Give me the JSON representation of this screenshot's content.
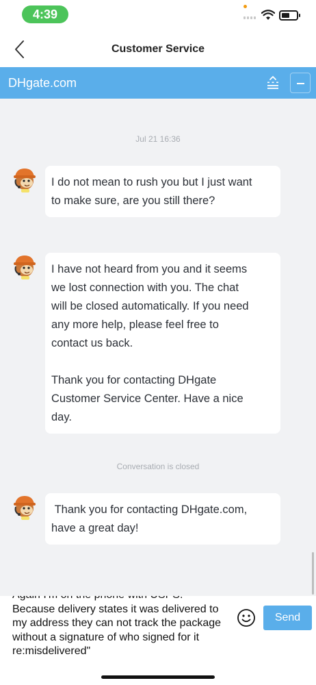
{
  "status_bar": {
    "time": "4:39",
    "time_pill_color": "#4cc45a",
    "icons": [
      "signal-icon",
      "wifi-icon",
      "battery-icon"
    ]
  },
  "nav": {
    "back_icon": "chevron-left-icon",
    "title": "Customer Service"
  },
  "brand_bar": {
    "name": "DHgate.com",
    "color": "#5aaeea",
    "icons": [
      "expand-icon",
      "minimize-icon"
    ]
  },
  "chat": {
    "timestamp": "Jul 21 16:36",
    "messages": [
      {
        "paragraphs": [
          "I do not mean to rush you but I just want\nto make sure, are you still there?"
        ]
      },
      {
        "paragraphs": [
          "I have not heard from you and it seems\nwe lost connection with you. The chat\nwill be closed automatically. If you need\nany more help, please feel free to\ncontact us back.",
          "Thank you for contacting DHgate\nCustomer Service Center. Have a nice\nday."
        ]
      },
      {
        "paragraphs": [
          " Thank you for contacting DHgate.com,\nhave a great day!"
        ]
      }
    ],
    "closed_note": "Conversation is closed"
  },
  "composer": {
    "value": "Again I'm on the phone with USPS.\nBecause delivery states it was delivered to\nmy address they can not track the package\nwithout a signature of who signed for it\nre:misdelivered\"",
    "emoji_icon": "smiley-face-icon",
    "send_label": "Send"
  }
}
